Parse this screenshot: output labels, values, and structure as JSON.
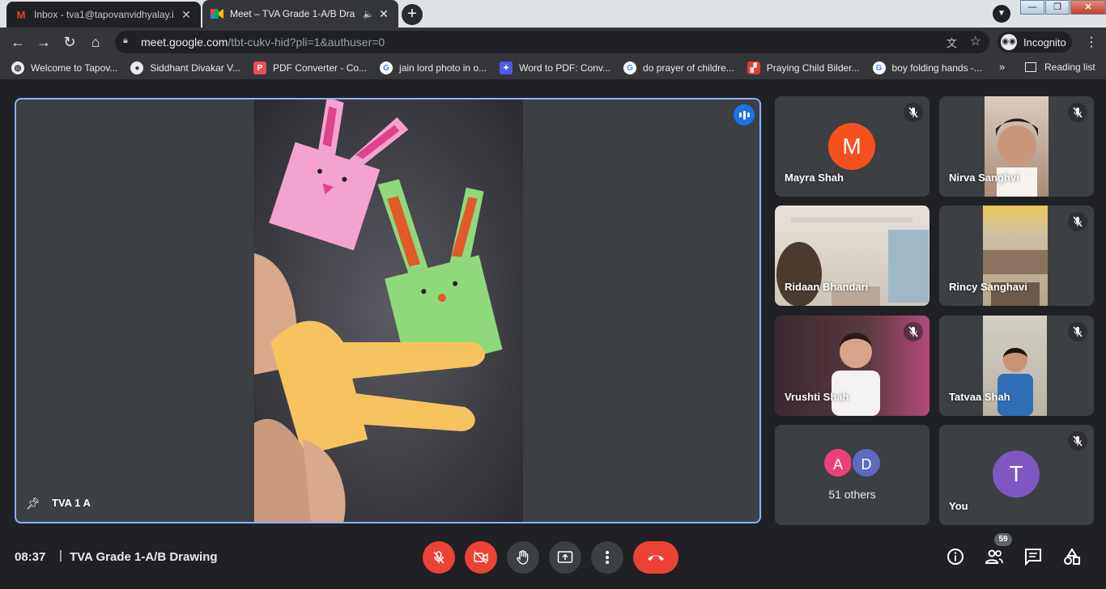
{
  "browser": {
    "tabs": [
      {
        "title": "Inbox - tva1@tapovanvidhyalay.i",
        "favicon": "gmail-icon",
        "active": false
      },
      {
        "title": "Meet – TVA Grade 1-A/B Dra",
        "favicon": "meet-icon",
        "active": true
      }
    ],
    "new_tab": "+",
    "url_host": "meet.google.com",
    "url_path": "/tbt-cukv-hid?pli=1&authuser=0",
    "incognito_label": "Incognito",
    "bookmarks": [
      {
        "label": "Welcome to Tapov...",
        "icon": "globe-icon"
      },
      {
        "label": "Siddhant Divakar V...",
        "icon": "person-icon"
      },
      {
        "label": "PDF Converter - Co...",
        "icon": "pdf-icon"
      },
      {
        "label": "jain lord photo in o...",
        "icon": "google-icon"
      },
      {
        "label": "Word to PDF: Conv...",
        "icon": "word-pdf-icon"
      },
      {
        "label": "do prayer of childre...",
        "icon": "google-icon"
      },
      {
        "label": "Praying Child Bilder...",
        "icon": "image-site-icon"
      },
      {
        "label": "boy folding hands -...",
        "icon": "google-icon"
      }
    ],
    "bookmarks_more": "»",
    "reading_list": "Reading list"
  },
  "meet": {
    "main_speaker": {
      "name": "TVA 1 A"
    },
    "participants": [
      {
        "name": "Mayra Shah",
        "initial": "M",
        "avatar_color": "#f4511e",
        "muted": true
      },
      {
        "name": "Nirva Sanghvi",
        "muted": true
      },
      {
        "name": "Ridaan Bhandari",
        "muted": false
      },
      {
        "name": "Rincy Sanghavi",
        "muted": true
      },
      {
        "name": "Vrushti Shah",
        "muted": true
      },
      {
        "name": "Tatvaa Shah",
        "muted": true
      }
    ],
    "others": {
      "initials": [
        "A",
        "D"
      ],
      "colors": [
        "#ec407a",
        "#5c6bc0"
      ],
      "label": "51 others"
    },
    "self": {
      "name": "You",
      "initial": "T",
      "avatar_color": "#7e57c2",
      "muted": true
    },
    "bottom": {
      "time": "08:37",
      "separator": "|",
      "meeting_title": "TVA Grade 1-A/B Drawing",
      "participant_count": "59"
    }
  },
  "colors": {
    "accent_blue": "#8ab4f8",
    "danger_red": "#ea4335",
    "surface": "#3c4043",
    "background": "#202124"
  }
}
